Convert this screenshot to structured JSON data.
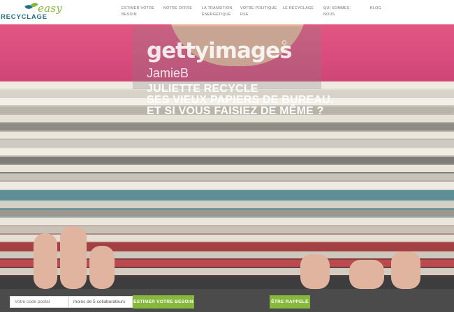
{
  "logo": {
    "easy": "easy",
    "recyclage": "RECYCLAGE"
  },
  "nav": [
    {
      "line1": "ESTIMER VOTRE",
      "line2": "BESOIN"
    },
    {
      "line1": "NOTRE OFFRE",
      "line2": ""
    },
    {
      "line1": "LA TRANSITION",
      "line2": "ÉNERGÉTIQUE"
    },
    {
      "line1": "VOTRE POLITIQUE",
      "line2": "RSE"
    },
    {
      "line1": "LE RECYCLAGE",
      "line2": ""
    },
    {
      "line1": "QUI SOMMES-",
      "line2": "NOUS"
    },
    {
      "line1": "BLOG",
      "line2": ""
    }
  ],
  "hero": {
    "watermark": "gettyimages",
    "photographer": "JamieB",
    "headline": [
      "JULIETTE RECYCLE",
      "SES VIEUX PAPIERS DE BUREAU.",
      "ET SI VOUS FAISIEZ DE MÊME ?"
    ]
  },
  "form": {
    "postal_placeholder": "Votre code postal",
    "size_value": "moins de 5 collaborateurs",
    "estimate_button": "ESTIMER VOTRE BESOIN",
    "callback_button": "ÊTRE RAPPELÉ"
  },
  "colors": {
    "brand_green": "#86b83c",
    "brand_blue": "#1f6e8c",
    "form_bar": "#4b4b4b"
  }
}
